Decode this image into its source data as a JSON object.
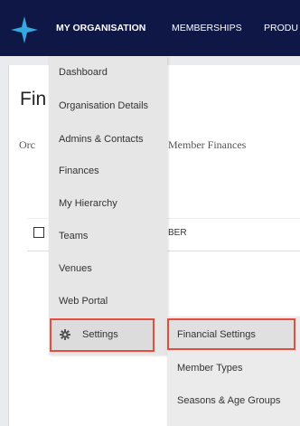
{
  "topnav": {
    "items": [
      {
        "label": "MY ORGANISATION"
      },
      {
        "label": "MEMBERSHIPS"
      },
      {
        "label": "PRODU"
      }
    ],
    "bg_color": "#0f1747",
    "logo_color": "#34a8e0"
  },
  "page": {
    "title": "Fin",
    "tab_left": "Orc",
    "tab_right": "Member Finances",
    "column_fragment": "BER"
  },
  "dropdown": {
    "items": [
      {
        "label": "Dashboard"
      },
      {
        "label": "Organisation Details"
      },
      {
        "label": "Admins & Contacts"
      },
      {
        "label": "Finances"
      },
      {
        "label": "My Hierarchy"
      },
      {
        "label": "Teams"
      },
      {
        "label": "Venues"
      },
      {
        "label": "Web Portal"
      }
    ],
    "settings_label": "Settings"
  },
  "submenu": {
    "items": [
      {
        "label": "Financial Settings"
      },
      {
        "label": "Member Types"
      },
      {
        "label": "Seasons & Age Groups"
      }
    ]
  },
  "highlight_color": "#e74c3c"
}
